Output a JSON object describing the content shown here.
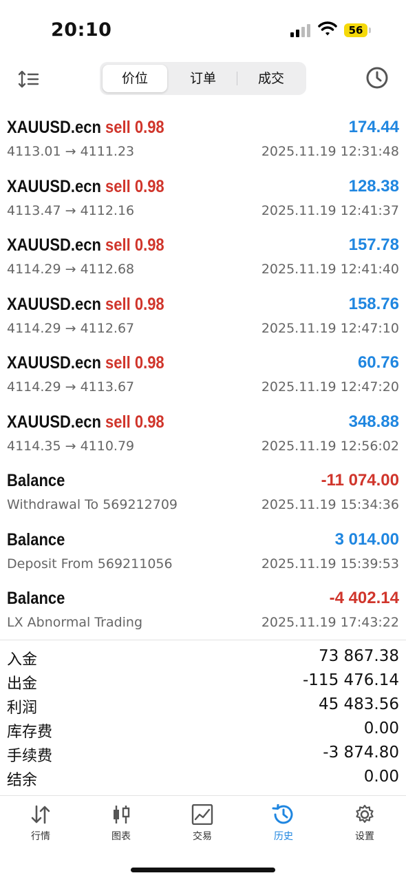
{
  "status": {
    "time": "20:10",
    "battery": "56"
  },
  "tabs_top": [
    {
      "label": "价位",
      "active": true
    },
    {
      "label": "订单",
      "active": false
    },
    {
      "label": "成交",
      "active": false
    }
  ],
  "deals": [
    {
      "symbol": "XAUUSD.ecn",
      "side": "sell 0.98",
      "amount": "174.44",
      "amount_color": "#1f86e0",
      "detail": "4113.01 → 4111.23",
      "time": "2025.11.19 12:31:48"
    },
    {
      "symbol": "XAUUSD.ecn",
      "side": "sell 0.98",
      "amount": "128.38",
      "amount_color": "#1f86e0",
      "detail": "4113.47 → 4112.16",
      "time": "2025.11.19 12:41:37"
    },
    {
      "symbol": "XAUUSD.ecn",
      "side": "sell 0.98",
      "amount": "157.78",
      "amount_color": "#1f86e0",
      "detail": "4114.29 → 4112.68",
      "time": "2025.11.19 12:41:40"
    },
    {
      "symbol": "XAUUSD.ecn",
      "side": "sell 0.98",
      "amount": "158.76",
      "amount_color": "#1f86e0",
      "detail": "4114.29 → 4112.67",
      "time": "2025.11.19 12:47:10"
    },
    {
      "symbol": "XAUUSD.ecn",
      "side": "sell 0.98",
      "amount": "60.76",
      "amount_color": "#1f86e0",
      "detail": "4114.29 → 4113.67",
      "time": "2025.11.19 12:47:20"
    },
    {
      "symbol": "XAUUSD.ecn",
      "side": "sell 0.98",
      "amount": "348.88",
      "amount_color": "#1f86e0",
      "detail": "4114.35 → 4110.79",
      "time": "2025.11.19 12:56:02"
    },
    {
      "symbol": "Balance",
      "side": "",
      "amount": "-11 074.00",
      "amount_color": "#d0352b",
      "detail": "Withdrawal To 569212709",
      "time": "2025.11.19 15:34:36"
    },
    {
      "symbol": "Balance",
      "side": "",
      "amount": "3 014.00",
      "amount_color": "#1f86e0",
      "detail": "Deposit From 569211056",
      "time": "2025.11.19 15:39:53"
    },
    {
      "symbol": "Balance",
      "side": "",
      "amount": "-4 402.14",
      "amount_color": "#d0352b",
      "detail": "LX Abnormal Trading",
      "time": "2025.11.19 17:43:22"
    }
  ],
  "summary": [
    {
      "label": "入金",
      "value": "73 867.38"
    },
    {
      "label": "出金",
      "value": "-115 476.14"
    },
    {
      "label": "利润",
      "value": "45 483.56"
    },
    {
      "label": "库存费",
      "value": "0.00"
    },
    {
      "label": "手续费",
      "value": "-3 874.80"
    },
    {
      "label": "结余",
      "value": "0.00"
    }
  ],
  "bottom_tabs": [
    {
      "label": "行情",
      "icon": "quotes-arrows-icon",
      "active": false
    },
    {
      "label": "图表",
      "icon": "candlestick-chart-icon",
      "active": false
    },
    {
      "label": "交易",
      "icon": "trade-chart-icon",
      "active": false
    },
    {
      "label": "历史",
      "icon": "history-clock-icon",
      "active": true
    },
    {
      "label": "设置",
      "icon": "gear-icon",
      "active": false
    }
  ],
  "colors": {
    "profit": "#1f86e0",
    "loss": "#d0352b",
    "accent": "#1f86e0"
  }
}
